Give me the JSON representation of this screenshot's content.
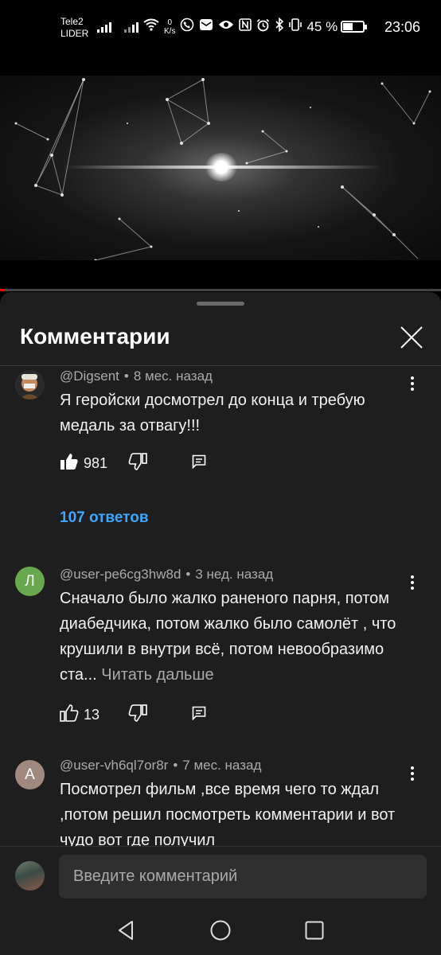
{
  "status_bar": {
    "carrier_1": "Tele2",
    "carrier_2": "LIDER",
    "speed_value": "0",
    "speed_unit": "K/s",
    "battery_percent": "45 %",
    "battery_level": 0.45,
    "time": "23:06"
  },
  "video": {
    "progress": 0.01
  },
  "sheet": {
    "title": "Комментарии",
    "close_icon": "close-icon"
  },
  "comments": [
    {
      "author": "@Digsent",
      "age": "8 мес. назад",
      "text": "Я геройски досмотрел до конца и требую медаль за отвагу!!!",
      "likes": "981",
      "liked": true,
      "replies": "107 ответов"
    },
    {
      "author": "@user-pe6cg3hw8d",
      "age": "3 нед. назад",
      "avatar_letter": "Л",
      "avatar_color": "#6aa84f",
      "text": "Сначало было жалко раненого парня, потом диабедчика, потом жалко было самолёт , что крушили в внутри всё, потом невообразимо ста...",
      "read_more": "Читать дальше",
      "likes": "13",
      "liked": false
    },
    {
      "author": "@user-vh6ql7or8r",
      "age": "7 мес. назад",
      "avatar_letter": "А",
      "avatar_color": "#a1887f",
      "text": "Посмотрел фильм ,все время чего то ждал ,потом решил посмотреть комментарии и вот чудо вот где получил"
    }
  ],
  "composer": {
    "placeholder": "Введите комментарий"
  },
  "colors": {
    "link": "#3ea6ff",
    "sheet_bg": "#1e1e1e",
    "progress": "#ff0000"
  }
}
